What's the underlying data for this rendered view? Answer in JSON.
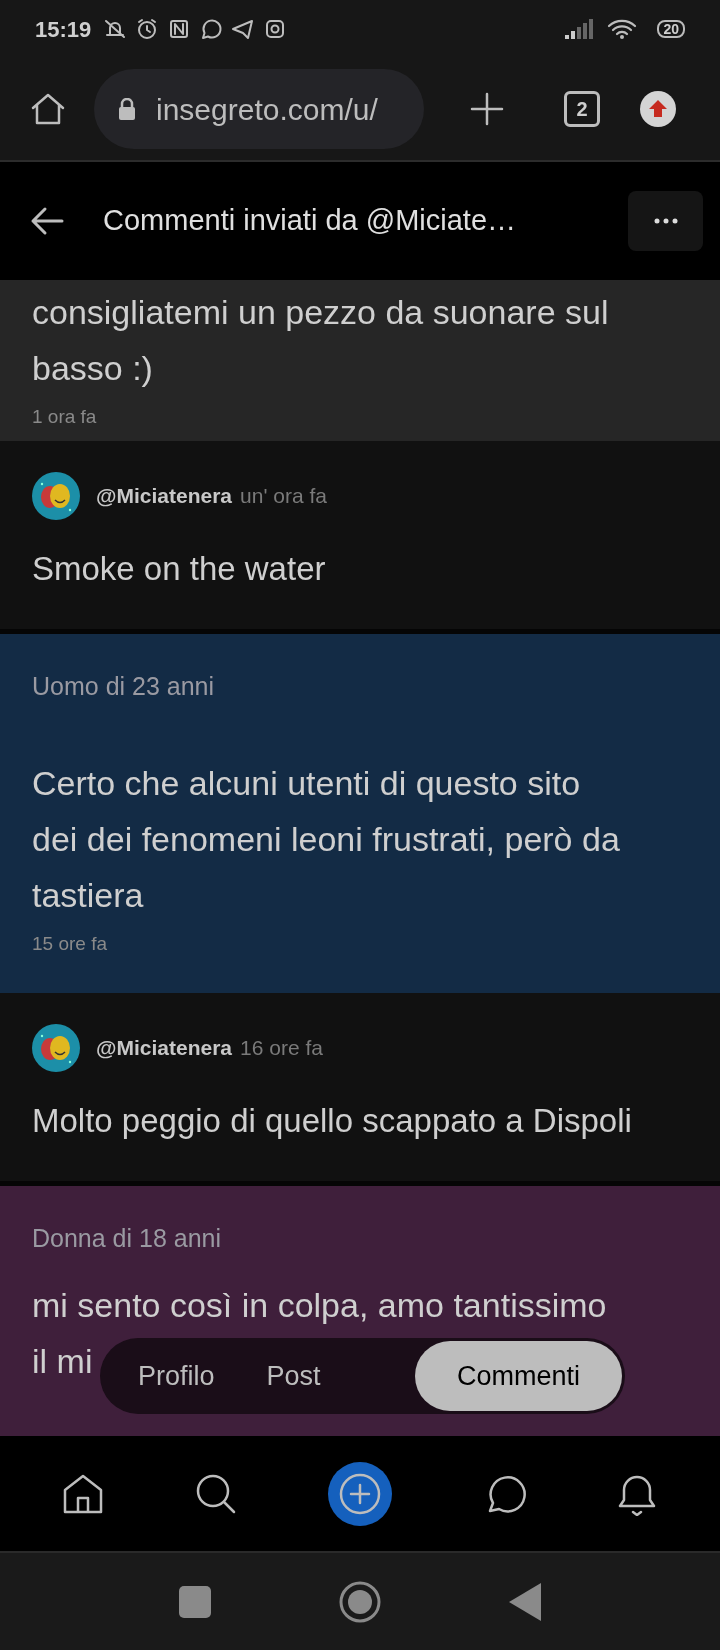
{
  "status_bar": {
    "time": "15:19",
    "battery": "20"
  },
  "browser": {
    "url": "insegreto.com/u/",
    "tab_count": "2"
  },
  "header": {
    "title": "Commenti inviati da @Miciate…"
  },
  "feed": [
    {
      "kind": "post",
      "color": "#262626",
      "body": "consigliatemi un pezzo da suonare sul basso :)",
      "time": "1 ora fa"
    },
    {
      "kind": "comment",
      "username": "@Miciatenera",
      "time": "un' ora fa",
      "body": "Smoke on the water"
    },
    {
      "kind": "post",
      "color": "#132b45",
      "meta": "Uomo di 23 anni",
      "body": "Certo che alcuni utenti di questo sito dei dei fenomeni leoni frustrati, però da tastiera",
      "time": "15 ore fa"
    },
    {
      "kind": "comment",
      "username": "@Miciatenera",
      "time": "16 ore fa",
      "body": "Molto peggio di quello scappato a Dispoli"
    },
    {
      "kind": "post",
      "color": "#3f1f3b",
      "meta": "Donna di 18 anni",
      "body_lines": [
        "mi sento così in colpa, amo tantissimo",
        "il mi"
      ]
    }
  ],
  "segments": [
    {
      "label": "Profilo",
      "selected": false
    },
    {
      "label": "Post",
      "selected": false
    },
    {
      "label": "Commenti",
      "selected": true
    }
  ]
}
